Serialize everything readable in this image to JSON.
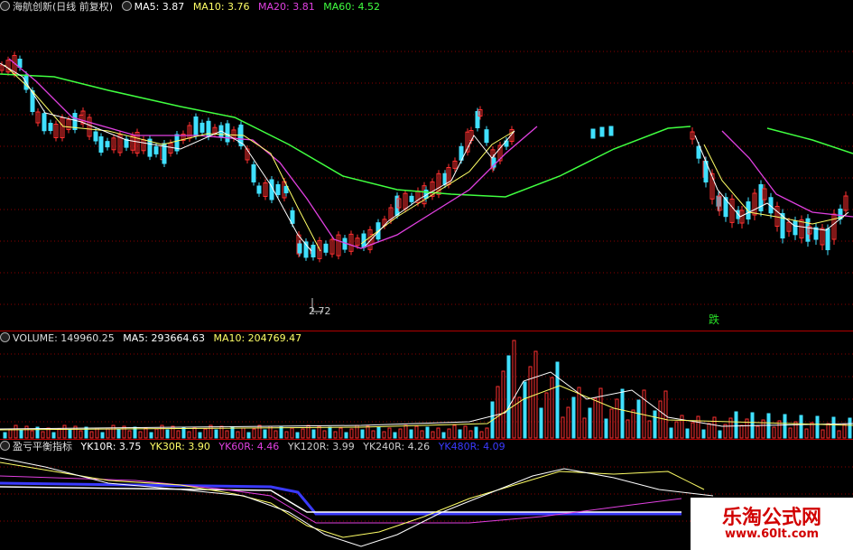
{
  "price_panel": {
    "title": "海航创新(日线 前复权)",
    "ma": [
      {
        "label": "MA5: 3.87",
        "color": "#ffffff"
      },
      {
        "label": "MA10: 3.76",
        "color": "#ffff66"
      },
      {
        "label": "MA20: 3.81",
        "color": "#e040e0"
      },
      {
        "label": "MA60: 4.52",
        "color": "#40ff40"
      }
    ],
    "low_label": "2.72",
    "down_marker": "跌"
  },
  "volume_panel": {
    "ma": [
      {
        "label": "VOLUME: 149960.25",
        "color": "#dddddd"
      },
      {
        "label": "MA5: 293664.63",
        "color": "#ffffff"
      },
      {
        "label": "MA10: 204769.47",
        "color": "#ffff66"
      }
    ]
  },
  "indicator_panel": {
    "title": "盈亏平衡指标",
    "lines": [
      {
        "label": "YK10R: 3.75",
        "color": "#ffffff"
      },
      {
        "label": "YK30R: 3.90",
        "color": "#ffff66"
      },
      {
        "label": "YK60R: 4.46",
        "color": "#e040e0"
      },
      {
        "label": "YK120R: 3.99",
        "color": "#cccccc"
      },
      {
        "label": "YK240R: 4.26",
        "color": "#cccccc"
      },
      {
        "label": "YK480R: 4.09",
        "color": "#3a3aff"
      }
    ]
  },
  "watermark": {
    "title": "乐淘公式网",
    "url": "www.60lt.com"
  },
  "colors": {
    "up": "#ff3030",
    "down": "#40e0ff",
    "grid": "#8b0000"
  }
}
